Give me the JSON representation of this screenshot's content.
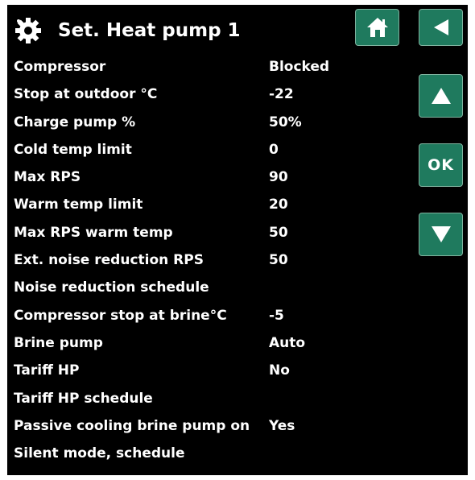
{
  "header": {
    "title": "Set. Heat pump 1",
    "icon": "gear-icon",
    "home_icon": "home-icon",
    "back_icon": "back-arrow-icon"
  },
  "nav": {
    "up_icon": "arrow-up-icon",
    "ok_label": "OK",
    "down_icon": "arrow-down-icon"
  },
  "colors": {
    "background": "#000000",
    "button": "#1f7a5e",
    "text": "#ffffff"
  },
  "settings": [
    {
      "label": "Compressor",
      "value": "Blocked"
    },
    {
      "label": "Stop at outdoor °C",
      "value": "-22"
    },
    {
      "label": "Charge pump %",
      "value": "50%"
    },
    {
      "label": "Cold temp limit",
      "value": "0"
    },
    {
      "label": "Max RPS",
      "value": "90"
    },
    {
      "label": "Warm temp limit",
      "value": "20"
    },
    {
      "label": "Max RPS warm temp",
      "value": "50"
    },
    {
      "label": "Ext. noise reduction RPS",
      "value": "50"
    },
    {
      "label": "Noise reduction schedule",
      "value": ""
    },
    {
      "label": "Compressor stop at brine°C",
      "value": "-5"
    },
    {
      "label": "Brine pump",
      "value": "Auto"
    },
    {
      "label": "Tariff HP",
      "value": "No"
    },
    {
      "label": "Tariff HP schedule",
      "value": ""
    },
    {
      "label": "Passive cooling brine pump on",
      "value": "Yes"
    },
    {
      "label": "Silent mode, schedule",
      "value": ""
    }
  ]
}
